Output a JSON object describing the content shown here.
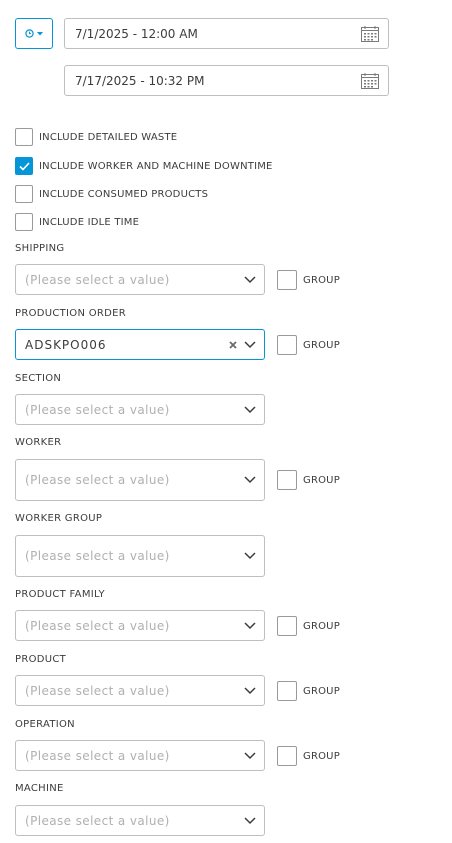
{
  "date_range": {
    "start": "7/1/2025 - 12:00 AM",
    "end": "7/17/2025 - 10:32 PM"
  },
  "options": [
    {
      "label": "INCLUDE DETAILED WASTE",
      "checked": false
    },
    {
      "label": "INCLUDE WORKER AND MACHINE DOWNTIME",
      "checked": true
    },
    {
      "label": "INCLUDE CONSUMED PRODUCTS",
      "checked": false
    },
    {
      "label": "INCLUDE IDLE TIME",
      "checked": false
    }
  ],
  "group_label": "GROUP",
  "placeholder": "(Please select a value)",
  "filters": {
    "shipping": {
      "label": "SHIPPING"
    },
    "production_order": {
      "label": "PRODUCTION ORDER",
      "value": "ADSKPO006"
    },
    "section": {
      "label": "SECTION"
    },
    "worker": {
      "label": "WORKER"
    },
    "worker_group": {
      "label": "WORKER GROUP"
    },
    "product_family": {
      "label": "PRODUCT FAMILY"
    },
    "product": {
      "label": "PRODUCT"
    },
    "operation": {
      "label": "OPERATION"
    },
    "machine": {
      "label": "MACHINE"
    }
  },
  "colors": {
    "accent": "#0696d7",
    "border": "#bfbfbf",
    "placeholder": "#b0b0b0"
  }
}
